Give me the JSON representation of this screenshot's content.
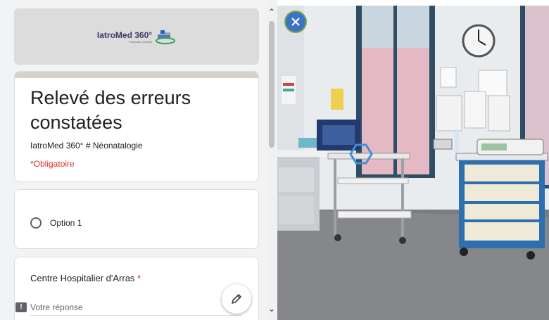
{
  "header": {
    "logo_text": "IatroMed 360°",
    "logo_subtext": "Formation virtuelle"
  },
  "form": {
    "title": "Relevé des erreurs constatées",
    "description": "IatroMed 360° # Néonatalogie",
    "required_note": "*Obligatoire",
    "option_label": "Option 1",
    "question_label": "Centre Hospitalier d'Arras",
    "required_star": "*",
    "answer_placeholder": "Votre réponse"
  },
  "icons": {
    "edit": "pencil-icon",
    "feedback": "feedback-icon",
    "close": "close-icon",
    "scroll_up": "chevron-up-icon",
    "scroll_down": "chevron-down-icon",
    "hotspot": "hexagon-hotspot-icon"
  },
  "colors": {
    "accent_bar": "#d5d3c8",
    "required": "#d93025",
    "close_button": "#3b73c4",
    "close_ring": "#7aa84a"
  }
}
